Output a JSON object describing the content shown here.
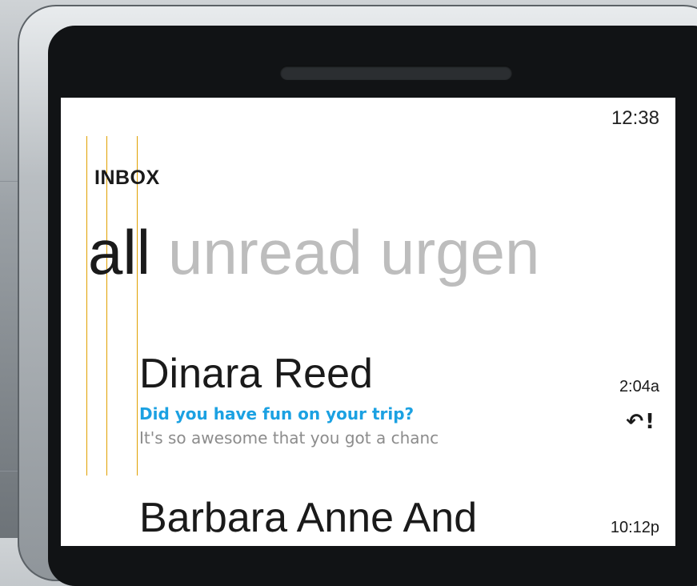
{
  "status_bar": {
    "time": "12:38"
  },
  "header": {
    "title": "INBOX"
  },
  "pivots": [
    "all",
    "unread",
    "urgen"
  ],
  "messages": [
    {
      "sender": "Dinara Reed",
      "subject": "Did you have fun on your trip?",
      "preview": "It's so awesome that you got a chanc",
      "time": "2:04a",
      "reply_icon": "↶",
      "urgent_icon": "!"
    },
    {
      "sender": "Barbara Anne And",
      "time": "10:12p"
    }
  ],
  "colors": {
    "accent": "#1ba1e2",
    "guides": "#e0a000"
  }
}
